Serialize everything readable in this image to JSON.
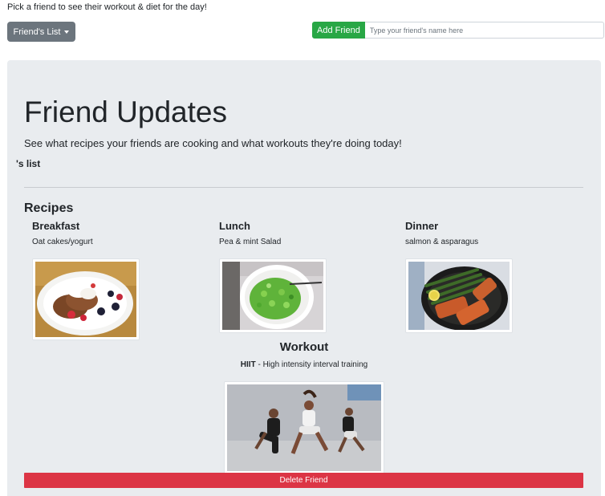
{
  "header": {
    "intro_text": "Pick a friend to see their workout & diet for the day!",
    "friends_dropdown_label": "Friend's List",
    "add_friend_label": "Add Friend",
    "friend_input_placeholder": "Type your friend's name here",
    "friend_input_value": ""
  },
  "updates": {
    "title": "Friend Updates",
    "subtitle": "See what recipes your friends are cooking and what workouts they're doing today!",
    "list_name": "'s list"
  },
  "recipes": {
    "heading": "Recipes",
    "meals": [
      {
        "title": "Breakfast",
        "description": "Oat cakes/yogurt",
        "image": "oat-cakes-yogurt-photo"
      },
      {
        "title": "Lunch",
        "description": "Pea & mint Salad",
        "image": "pea-mint-salad-photo"
      },
      {
        "title": "Dinner",
        "description": "salmon & asparagus",
        "image": "salmon-asparagus-photo"
      }
    ]
  },
  "workout": {
    "heading": "Workout",
    "name": "HIIT",
    "separator": " - ",
    "description": "High intensity interval training",
    "image": "hiit-jumping-photo"
  },
  "actions": {
    "delete_label": "Delete Friend"
  },
  "colors": {
    "secondary": "#6c757d",
    "success": "#28a745",
    "danger": "#dc3545",
    "jumbotron_bg": "#e9ecef"
  }
}
